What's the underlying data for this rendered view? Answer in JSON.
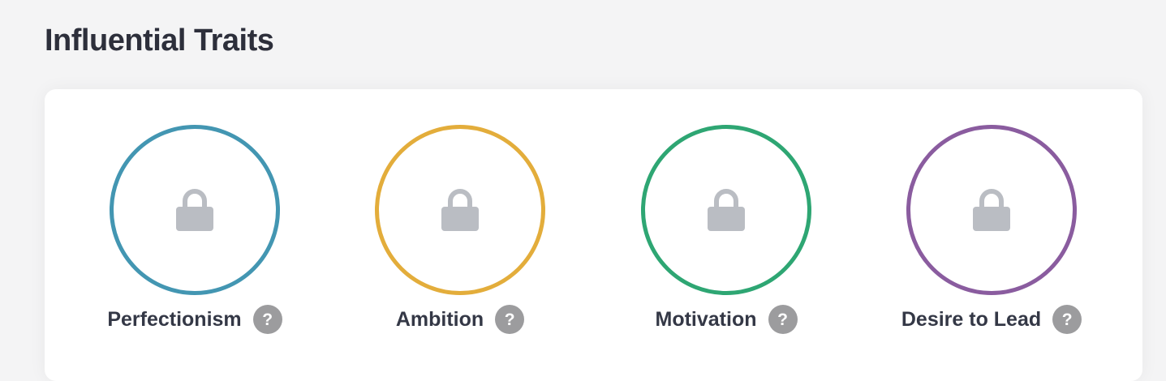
{
  "page": {
    "title": "Influential Traits"
  },
  "traits": [
    {
      "label": "Perfectionism",
      "color": "#4396b2",
      "locked": true,
      "help_symbol": "?",
      "icon": "lock-icon",
      "help_icon": "question-mark-icon"
    },
    {
      "label": "Ambition",
      "color": "#e3ad3b",
      "locked": true,
      "help_symbol": "?",
      "icon": "lock-icon",
      "help_icon": "question-mark-icon"
    },
    {
      "label": "Motivation",
      "color": "#2ea673",
      "locked": true,
      "help_symbol": "?",
      "icon": "lock-icon",
      "help_icon": "question-mark-icon"
    },
    {
      "label": "Desire to Lead",
      "color": "#8a5c9f",
      "locked": true,
      "help_symbol": "?",
      "icon": "lock-icon",
      "help_icon": "question-mark-icon"
    }
  ],
  "colors": {
    "background": "#f4f4f5",
    "card": "#ffffff",
    "title_text": "#2d2f3b",
    "label_text": "#343846",
    "lock": "#babdc3",
    "help_badge": "#9c9c9e"
  }
}
